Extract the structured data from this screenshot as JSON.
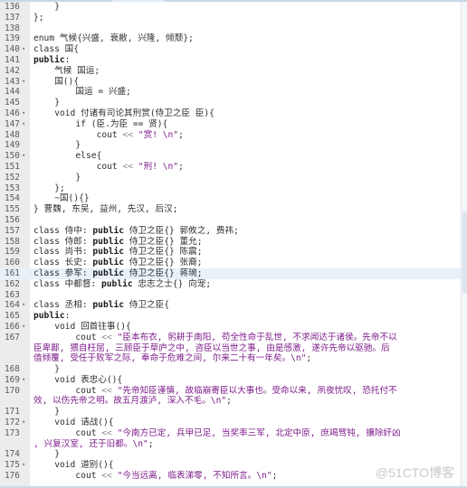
{
  "editor": {
    "highlighted_line": "161",
    "lines": [
      {
        "n": "136",
        "fold": false,
        "indent": 1,
        "text": "}"
      },
      {
        "n": "137",
        "fold": false,
        "indent": 0,
        "text": "};"
      },
      {
        "n": "138",
        "fold": false,
        "indent": 0,
        "text": ""
      },
      {
        "n": "139",
        "fold": false,
        "indent": 0,
        "text": "enum 气候{兴盛, 衰敝, 兴隆, 倾颓};"
      },
      {
        "n": "140",
        "fold": true,
        "indent": 0,
        "text": "class 国{"
      },
      {
        "n": "141",
        "fold": false,
        "indent": 0,
        "text": "public:"
      },
      {
        "n": "142",
        "fold": false,
        "indent": 1,
        "text": "气候 国运;"
      },
      {
        "n": "143",
        "fold": true,
        "indent": 1,
        "text": "国(){"
      },
      {
        "n": "144",
        "fold": false,
        "indent": 2,
        "text": "国运 = 兴盛;"
      },
      {
        "n": "145",
        "fold": false,
        "indent": 1,
        "text": "}"
      },
      {
        "n": "146",
        "fold": true,
        "indent": 1,
        "text": "void 付诸有司论其刑赏(侍卫之臣 臣){"
      },
      {
        "n": "147",
        "fold": true,
        "indent": 2,
        "text": "if (臣.为臣 == 贤){"
      },
      {
        "n": "148",
        "fold": false,
        "indent": 3,
        "text": "cout << \"赏! \\n\";"
      },
      {
        "n": "149",
        "fold": false,
        "indent": 2,
        "text": "}"
      },
      {
        "n": "150",
        "fold": true,
        "indent": 2,
        "text": "else{"
      },
      {
        "n": "151",
        "fold": false,
        "indent": 3,
        "text": "cout << \"刑! \\n\";"
      },
      {
        "n": "152",
        "fold": false,
        "indent": 2,
        "text": "}"
      },
      {
        "n": "153",
        "fold": false,
        "indent": 1,
        "text": "};"
      },
      {
        "n": "154",
        "fold": false,
        "indent": 1,
        "text": "~国(){}"
      },
      {
        "n": "155",
        "fold": false,
        "indent": 0,
        "text": "} 曹魏, 东吴, 益州, 先汉, 后汉;"
      },
      {
        "n": "156",
        "fold": false,
        "indent": 0,
        "text": ""
      },
      {
        "n": "157",
        "fold": false,
        "indent": 0,
        "text": "class 侍中: public 侍卫之臣{} 郭攸之, 费祎;"
      },
      {
        "n": "158",
        "fold": false,
        "indent": 0,
        "text": "class 侍郎: public 侍卫之臣{} 董允;"
      },
      {
        "n": "159",
        "fold": false,
        "indent": 0,
        "text": "class 尚书: public 侍卫之臣{} 陈震;"
      },
      {
        "n": "160",
        "fold": false,
        "indent": 0,
        "text": "class 长史: public 侍卫之臣{} 张裔;"
      },
      {
        "n": "161",
        "fold": false,
        "indent": 0,
        "text": "class 参军: public 侍卫之臣{} 蒋琬;"
      },
      {
        "n": "162",
        "fold": false,
        "indent": 0,
        "text": "class 中都督: public 忠志之士{} 向宠;"
      },
      {
        "n": "163",
        "fold": false,
        "indent": 0,
        "text": ""
      },
      {
        "n": "164",
        "fold": true,
        "indent": 0,
        "text": "class 丞相: public 侍卫之臣{"
      },
      {
        "n": "165",
        "fold": false,
        "indent": 0,
        "text": "public:"
      },
      {
        "n": "166",
        "fold": true,
        "indent": 1,
        "text": "void 回首往事(){"
      },
      {
        "n": "167",
        "fold": false,
        "indent": 2,
        "text": "cout << \"臣本布衣, 躬耕于南阳, 苟全性命于乱世, 不求闻达于诸侯。先帝不以",
        "wrap": [
          "臣卑鄙, 猥自枉屈, 三顾臣于草庐之中, 咨臣以当世之事, 由是感激, 遂许先帝以驱驰。后",
          "值倾覆, 受任于败军之际, 奉命于危难之间, 尔来二十有一年矣。\\n\";"
        ]
      },
      {
        "n": "168",
        "fold": false,
        "indent": 1,
        "text": "}"
      },
      {
        "n": "169",
        "fold": true,
        "indent": 1,
        "text": "void 表忠心(){"
      },
      {
        "n": "170",
        "fold": false,
        "indent": 2,
        "text": "cout << \"先帝知臣谨慎, 故临崩寄臣以大事也。受命以来, 夙夜忧叹, 恐托付不",
        "wrap": [
          "效, 以伤先帝之明。故五月渡泸, 深入不毛。\\n\";"
        ]
      },
      {
        "n": "171",
        "fold": false,
        "indent": 1,
        "text": "}"
      },
      {
        "n": "172",
        "fold": true,
        "indent": 1,
        "text": "void 请战(){"
      },
      {
        "n": "173",
        "fold": false,
        "indent": 2,
        "text": "cout << \"今南方已定, 兵甲已足, 当奖率三军, 北定中原, 庶竭驽钝, 攘除奸凶",
        "wrap": [
          ", 兴复汉室, 还于旧都。\\n\";"
        ]
      },
      {
        "n": "174",
        "fold": false,
        "indent": 1,
        "text": "}"
      },
      {
        "n": "175",
        "fold": true,
        "indent": 1,
        "text": "void 道别(){"
      },
      {
        "n": "176",
        "fold": false,
        "indent": 2,
        "text": "cout << \"今当远离, 临表涕零, 不知所言。\\n\";"
      }
    ]
  },
  "watermark": "@51CTO博客",
  "colors": {
    "string": "#7d1c8a",
    "gutter": "#ececec",
    "highlight": "#e8f0fa"
  }
}
